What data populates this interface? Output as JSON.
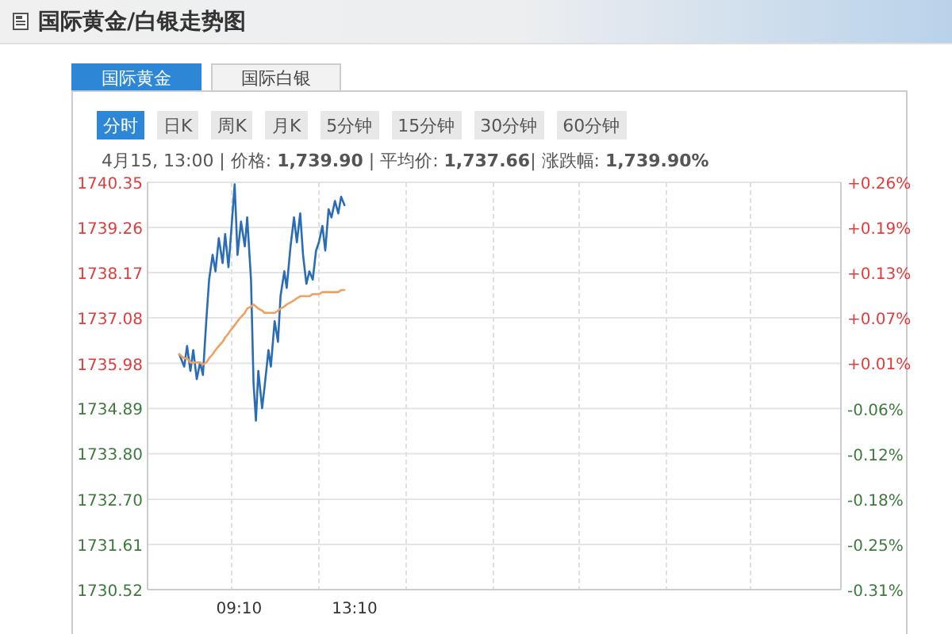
{
  "header": {
    "title": "国际黄金/白银走势图"
  },
  "tabs": [
    {
      "label": "国际黄金",
      "selected": true
    },
    {
      "label": "国际白银",
      "selected": false
    }
  ],
  "periods": [
    {
      "label": "分时",
      "selected": true
    },
    {
      "label": "日K",
      "selected": false
    },
    {
      "label": "周K",
      "selected": false
    },
    {
      "label": "月K",
      "selected": false
    },
    {
      "label": "5分钟",
      "selected": false
    },
    {
      "label": "15分钟",
      "selected": false
    },
    {
      "label": "30分钟",
      "selected": false
    },
    {
      "label": "60分钟",
      "selected": false
    }
  ],
  "info": "4月15, 13:00 | 价格: **1,739.90** | 平均价: **1,737.66**| 涨跌幅: **1,739.90%**",
  "chart_data": {
    "type": "line",
    "grid": true,
    "xlim": [
      360,
      1800
    ],
    "ylim": [
      1730.52,
      1740.35
    ],
    "x": [
      426,
      436,
      442,
      449,
      455,
      462,
      469,
      475,
      482,
      488,
      495,
      501,
      508,
      516,
      521,
      528,
      534,
      541,
      547,
      554,
      562,
      567,
      575,
      580,
      585,
      590,
      598,
      603,
      611,
      616,
      624,
      631,
      636,
      644,
      649,
      657,
      664,
      670,
      677,
      683,
      690,
      696,
      703,
      710,
      716,
      723,
      729,
      736,
      742,
      749,
      756,
      762,
      769
    ],
    "series": [
      {
        "color": "#2a6db5",
        "values": [
          1736.2,
          1735.9,
          1736.4,
          1735.8,
          1736.3,
          1735.6,
          1736.0,
          1735.7,
          1737.0,
          1738.0,
          1738.6,
          1738.2,
          1739.0,
          1738.4,
          1739.1,
          1738.3,
          1739.2,
          1740.3,
          1738.6,
          1739.4,
          1738.8,
          1739.5,
          1738.0,
          1735.5,
          1734.6,
          1735.8,
          1734.9,
          1735.4,
          1736.3,
          1735.9,
          1737.0,
          1736.5,
          1737.6,
          1738.2,
          1737.8,
          1738.8,
          1739.5,
          1738.9,
          1739.6,
          1738.6,
          1737.9,
          1738.2,
          1738.0,
          1738.7,
          1738.9,
          1739.3,
          1738.7,
          1739.7,
          1739.5,
          1739.9,
          1739.6,
          1740.0,
          1739.8
        ]
      },
      {
        "color": "#f0a060",
        "values": [
          1736.2,
          1736.1,
          1736.1,
          1736.0,
          1736.0,
          1736.0,
          1736.0,
          1735.95,
          1736.0,
          1736.1,
          1736.2,
          1736.3,
          1736.4,
          1736.5,
          1736.6,
          1736.7,
          1736.8,
          1736.9,
          1737.0,
          1737.1,
          1737.2,
          1737.3,
          1737.35,
          1737.4,
          1737.35,
          1737.3,
          1737.25,
          1737.2,
          1737.2,
          1737.2,
          1737.2,
          1737.25,
          1737.3,
          1737.35,
          1737.4,
          1737.45,
          1737.5,
          1737.55,
          1737.6,
          1737.6,
          1737.6,
          1737.6,
          1737.65,
          1737.65,
          1737.65,
          1737.7,
          1737.7,
          1737.7,
          1737.7,
          1737.7,
          1737.7,
          1737.75,
          1737.75
        ]
      }
    ],
    "xticks": [
      {
        "value": 550,
        "label": "09:10"
      },
      {
        "value": 790,
        "label": "13:10"
      }
    ],
    "yticks": [
      {
        "value": 1740.35,
        "label": "1740.35"
      },
      {
        "value": 1739.26,
        "label": "1739.26"
      },
      {
        "value": 1738.17,
        "label": "1738.17"
      },
      {
        "value": 1737.08,
        "label": "1737.08"
      },
      {
        "value": 1735.98,
        "label": "1735.98"
      },
      {
        "value": 1734.89,
        "label": "1734.89"
      },
      {
        "value": 1733.8,
        "label": "1733.80"
      },
      {
        "value": 1732.7,
        "label": "1732.70"
      },
      {
        "value": 1731.61,
        "label": "1731.61"
      },
      {
        "value": 1730.52,
        "label": "1730.52"
      }
    ]
  },
  "right_axis": [
    {
      "label": "+0.26%",
      "up": true
    },
    {
      "label": "+0.19%",
      "up": true
    },
    {
      "label": "+0.13%",
      "up": true
    },
    {
      "label": "+0.07%",
      "up": true
    },
    {
      "label": "+0.01%",
      "up": true
    },
    {
      "label": "-0.06%",
      "up": false
    },
    {
      "label": "-0.12%",
      "up": false
    },
    {
      "label": "-0.18%",
      "up": false
    },
    {
      "label": "-0.25%",
      "up": false
    },
    {
      "label": "-0.31%",
      "up": false
    }
  ]
}
